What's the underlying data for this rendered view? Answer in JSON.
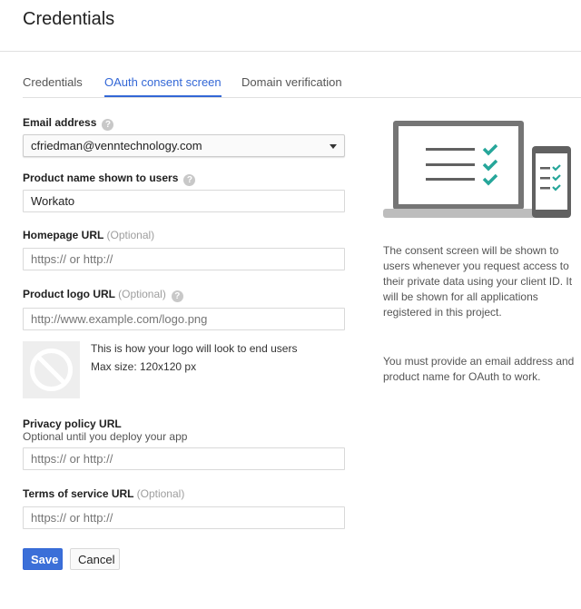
{
  "header": {
    "title": "Credentials"
  },
  "tabs": [
    {
      "label": "Credentials",
      "active": false
    },
    {
      "label": "OAuth consent screen",
      "active": true
    },
    {
      "label": "Domain verification",
      "active": false
    }
  ],
  "form": {
    "email": {
      "label": "Email address",
      "value": "cfriedman@venntechnology.com",
      "help_icon": "help-icon"
    },
    "product_name": {
      "label": "Product name shown to users",
      "value": "Workato",
      "help_icon": "help-icon"
    },
    "homepage": {
      "label": "Homepage URL",
      "optional": "(Optional)",
      "placeholder": "https:// or http://"
    },
    "logo_url": {
      "label": "Product logo URL",
      "optional": "(Optional)",
      "placeholder": "http://www.example.com/logo.png",
      "help_icon": "help-icon"
    },
    "logo_preview": {
      "icon": "no-image-icon",
      "line1": "This is how your logo will look to end users",
      "line2": "Max size: 120x120 px"
    },
    "privacy": {
      "label": "Privacy policy URL",
      "sublabel": "Optional until you deploy your app",
      "placeholder": "https:// or http://"
    },
    "tos": {
      "label": "Terms of service URL",
      "optional": "(Optional)",
      "placeholder": "https:// or http://"
    },
    "save_label": "Save",
    "cancel_label": "Cancel"
  },
  "sidebar": {
    "illustration": "devices-consent-icon",
    "paragraph1": "The consent screen will be shown to users whenever you request access to their private data using your client ID. It will be shown for all applications registered in this project.",
    "paragraph2": "You must provide an email address and product name for OAuth to work."
  },
  "colors": {
    "accent": "#3367d6",
    "check": "#26a69a"
  }
}
